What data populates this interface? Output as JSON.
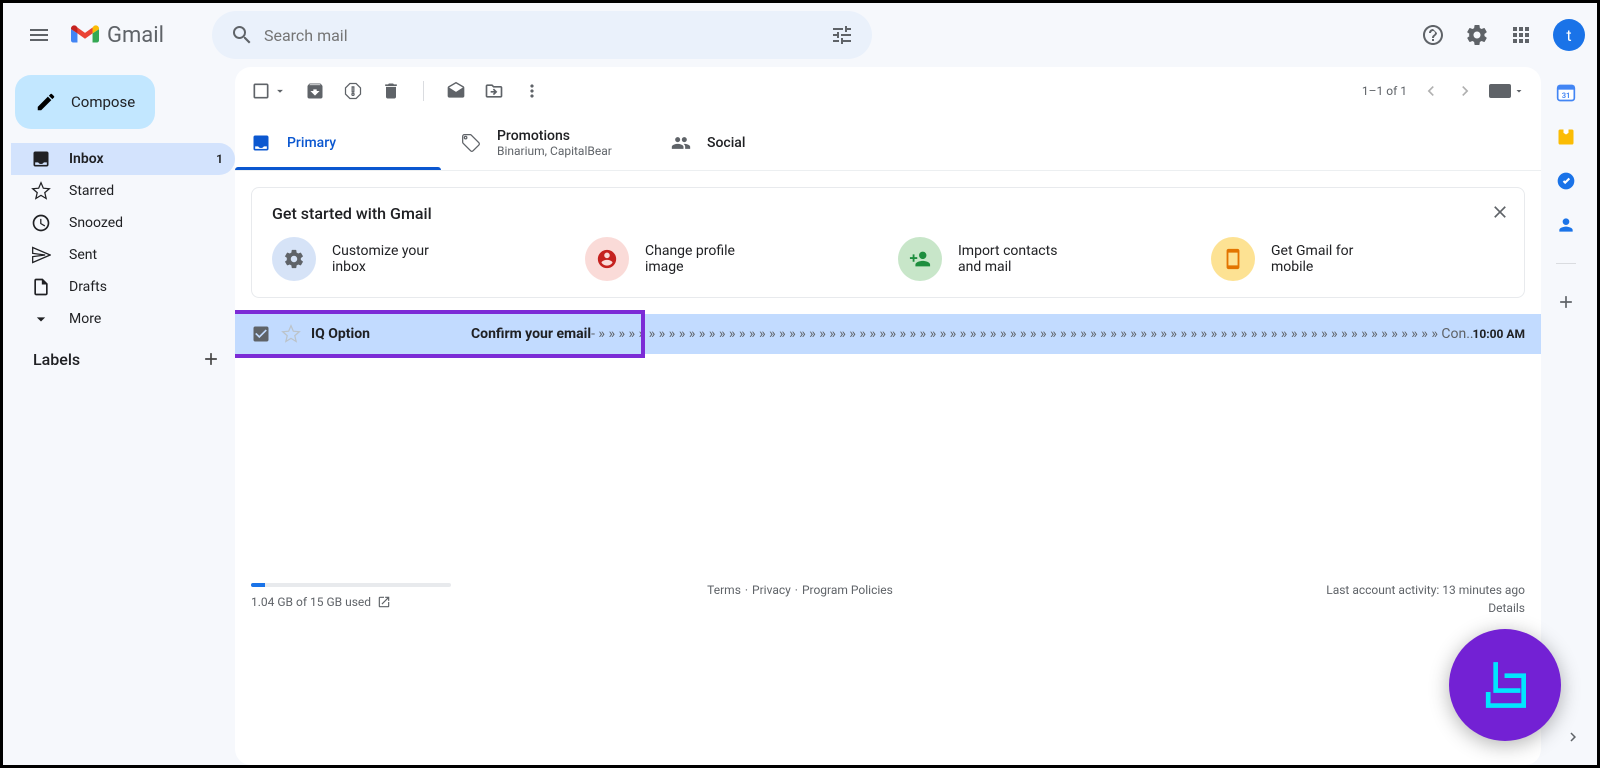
{
  "header": {
    "logo_text": "Gmail",
    "search_placeholder": "Search mail",
    "avatar_letter": "t"
  },
  "compose_label": "Compose",
  "sidebar": [
    {
      "label": "Inbox",
      "count": "1",
      "active": true
    },
    {
      "label": "Starred",
      "count": "",
      "active": false
    },
    {
      "label": "Snoozed",
      "count": "",
      "active": false
    },
    {
      "label": "Sent",
      "count": "",
      "active": false
    },
    {
      "label": "Drafts",
      "count": "",
      "active": false
    },
    {
      "label": "More",
      "count": "",
      "active": false
    }
  ],
  "labels_header": "Labels",
  "toolbar": {
    "range": "1–1 of 1"
  },
  "tabs": {
    "primary": "Primary",
    "promotions": "Promotions",
    "promotions_sub": "Binarium, CapitalBear",
    "social": "Social"
  },
  "getstarted": {
    "title": "Get started with Gmail",
    "cards": [
      {
        "label": "Customize your inbox"
      },
      {
        "label": "Change profile image"
      },
      {
        "label": "Import contacts and mail"
      },
      {
        "label": "Get Gmail for mobile"
      }
    ]
  },
  "email": {
    "sender": "IQ Option",
    "subject": "Confirm your email",
    "snippet": " - » » » » » » » » » » » » » » » » » » » » » » » » » » » » » » » » » » » » » » » » » » » » » » » » » » » » » » » » » » » » » » » » » » » » » » » » » » » » » » » » » » » » Con...",
    "time": "10:00 AM"
  },
  "footer": {
    "storage": "1.04 GB of 15 GB used",
    "terms": "Terms",
    "privacy": "Privacy",
    "policies": "Program Policies",
    "sep": " · ",
    "activity": "Last account activity: 13 minutes ago",
    "details": "Details"
  }
}
